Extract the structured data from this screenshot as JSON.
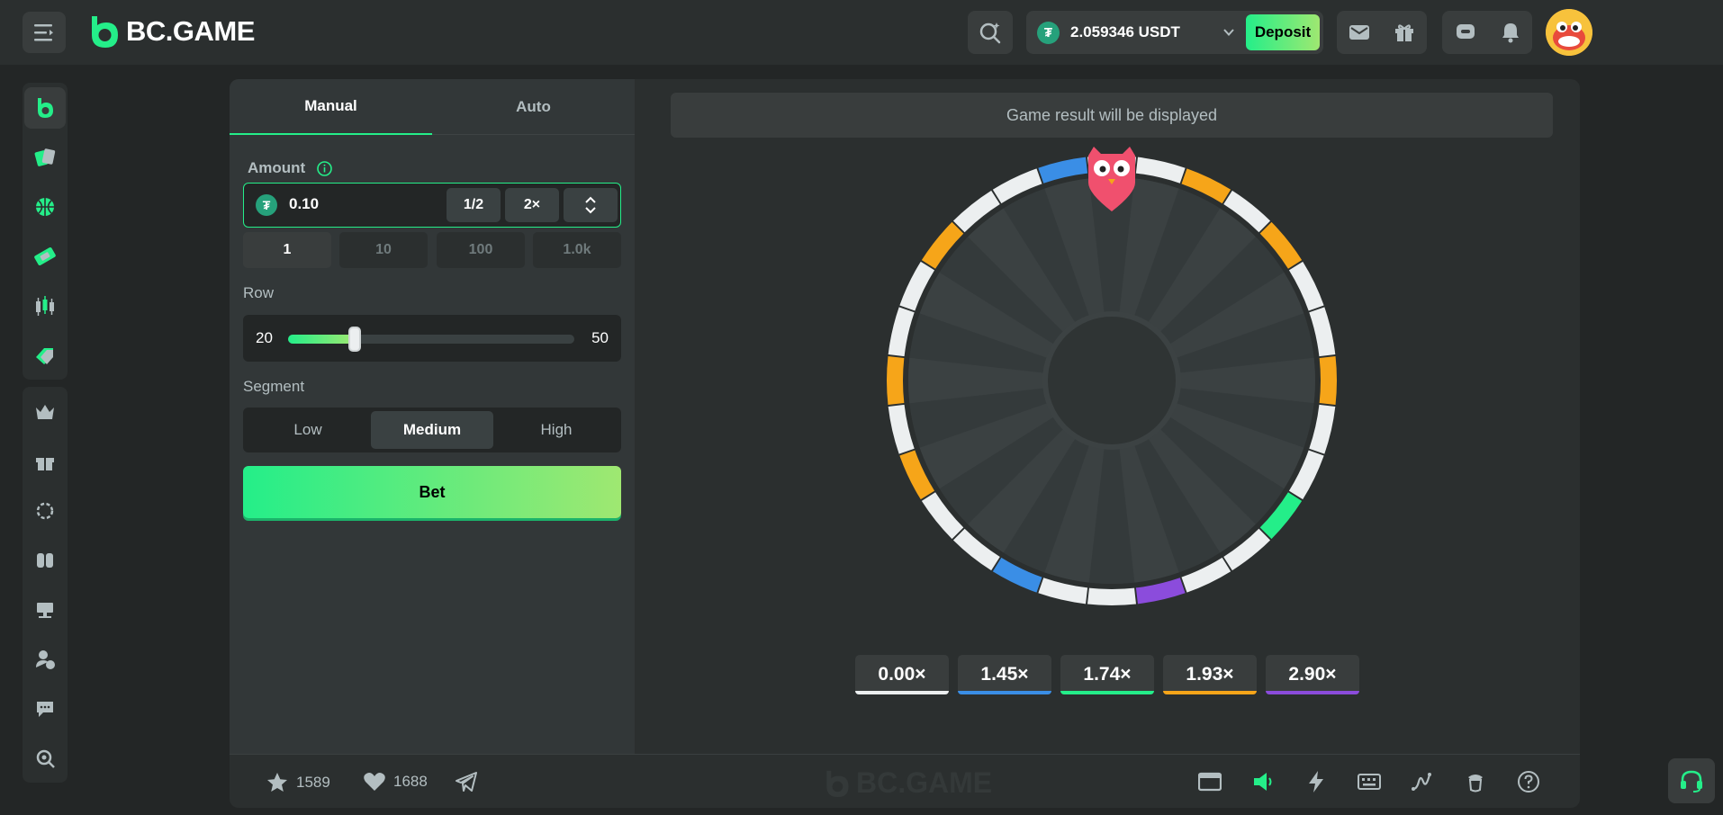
{
  "brand": {
    "name": "BC.GAME",
    "accent": "#24ee89"
  },
  "header": {
    "menu_icon": "menu-icon",
    "search_icon": "search-icon",
    "wallet": {
      "amount": "2.059346 USDT",
      "coin_symbol": "₮",
      "coin_color": "#26a17b"
    },
    "deposit_label": "Deposit",
    "icons": [
      "mail-icon",
      "gift-icon",
      "chat-icon",
      "bell-icon"
    ]
  },
  "sidebar": {
    "items": [
      "bc-icon",
      "casino-icon",
      "sports-icon",
      "lottery-icon",
      "trading-icon",
      "promotions-icon",
      "vip-icon",
      "gift-icon",
      "spin-icon",
      "games-icon",
      "streams-icon",
      "affiliate-icon",
      "chat-icon",
      "provably-fair-icon"
    ]
  },
  "panel": {
    "tabs": [
      {
        "label": "Manual",
        "active": true
      },
      {
        "label": "Auto",
        "active": false
      }
    ],
    "amount_label": "Amount",
    "amount_value": "0.10",
    "half_label": "1/2",
    "double_label": "2×",
    "quick_amounts": [
      {
        "label": "1",
        "active": true
      },
      {
        "label": "10",
        "active": false
      },
      {
        "label": "100",
        "active": false
      },
      {
        "label": "1.0k",
        "active": false
      }
    ],
    "row_label": "Row",
    "row_min": "20",
    "row_max": "50",
    "row_value": 27,
    "segment_label": "Segment",
    "segments": [
      {
        "label": "Low",
        "active": false
      },
      {
        "label": "Medium",
        "active": true
      },
      {
        "label": "High",
        "active": false
      }
    ],
    "bet_label": "Bet"
  },
  "game": {
    "result_text": "Game result will be displayed",
    "wheel_segments": [
      "#eceff0",
      "#eceff0",
      "#f6a519",
      "#eceff0",
      "#f6a519",
      "#eceff0",
      "#eceff0",
      "#f6a519",
      "#eceff0",
      "#eceff0",
      "#24ee89",
      "#eceff0",
      "#eceff0",
      "#8b4cdc",
      "#eceff0",
      "#eceff0",
      "#3a8ee6",
      "#eceff0",
      "#eceff0",
      "#f6a519",
      "#eceff0",
      "#f6a519",
      "#eceff0",
      "#eceff0",
      "#f6a519",
      "#eceff0",
      "#eceff0",
      "#3a8ee6"
    ],
    "multipliers": [
      {
        "label": "0.00×",
        "color": "#eceff0"
      },
      {
        "label": "1.45×",
        "color": "#3a8ee6"
      },
      {
        "label": "1.74×",
        "color": "#24ee89"
      },
      {
        "label": "1.93×",
        "color": "#f6a519"
      },
      {
        "label": "2.90×",
        "color": "#8b4cdc"
      }
    ]
  },
  "footer": {
    "favorites": "1589",
    "likes": "1688",
    "logo": "BC.GAME",
    "icons": [
      "theater-mode-icon",
      "sound-icon",
      "hotkeys-icon",
      "keyboard-icon",
      "stats-icon",
      "fairness-icon",
      "help-icon"
    ]
  }
}
